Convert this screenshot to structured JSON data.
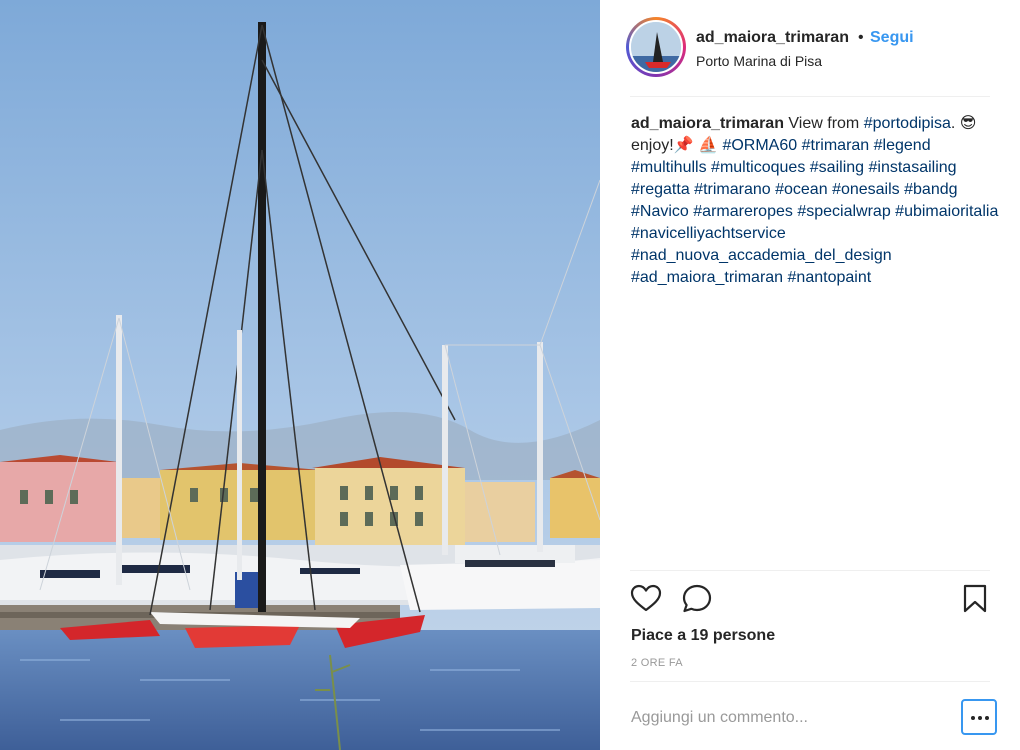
{
  "header": {
    "username": "ad_maiora_trimaran",
    "separator": "•",
    "follow_label": "Segui",
    "location": "Porto Marina di Pisa"
  },
  "caption": {
    "username": "ad_maiora_trimaran",
    "segments": [
      {
        "type": "text",
        "text": " View from "
      },
      {
        "type": "tag",
        "text": "#portodipisa"
      },
      {
        "type": "text",
        "text": ". "
      },
      {
        "type": "emoji",
        "text": "😎"
      },
      {
        "type": "text",
        "text": " enjoy!"
      },
      {
        "type": "emoji",
        "text": "📌"
      },
      {
        "type": "text",
        "text": " "
      },
      {
        "type": "emoji",
        "text": "⛵"
      },
      {
        "type": "text",
        "text": " "
      },
      {
        "type": "tag",
        "text": "#ORMA60"
      },
      {
        "type": "text",
        "text": " "
      },
      {
        "type": "tag",
        "text": "#trimaran"
      },
      {
        "type": "text",
        "text": " "
      },
      {
        "type": "tag",
        "text": "#legend"
      },
      {
        "type": "text",
        "text": " "
      },
      {
        "type": "tag",
        "text": "#multihulls"
      },
      {
        "type": "text",
        "text": " "
      },
      {
        "type": "tag",
        "text": "#multicoques"
      },
      {
        "type": "text",
        "text": " "
      },
      {
        "type": "tag",
        "text": "#sailing"
      },
      {
        "type": "text",
        "text": " "
      },
      {
        "type": "tag",
        "text": "#instasailing"
      },
      {
        "type": "text",
        "text": " "
      },
      {
        "type": "tag",
        "text": "#regatta"
      },
      {
        "type": "text",
        "text": " "
      },
      {
        "type": "tag",
        "text": "#trimarano"
      },
      {
        "type": "text",
        "text": " "
      },
      {
        "type": "tag",
        "text": "#ocean"
      },
      {
        "type": "text",
        "text": " "
      },
      {
        "type": "tag",
        "text": "#onesails"
      },
      {
        "type": "text",
        "text": " "
      },
      {
        "type": "tag",
        "text": "#bandg"
      },
      {
        "type": "text",
        "text": " "
      },
      {
        "type": "tag",
        "text": "#Navico"
      },
      {
        "type": "text",
        "text": " "
      },
      {
        "type": "tag",
        "text": "#armareropes"
      },
      {
        "type": "text",
        "text": " "
      },
      {
        "type": "tag",
        "text": "#specialwrap"
      },
      {
        "type": "text",
        "text": " "
      },
      {
        "type": "tag",
        "text": "#ubimaioritalia"
      },
      {
        "type": "text",
        "text": " "
      },
      {
        "type": "tag",
        "text": "#navicelliyachtservice"
      },
      {
        "type": "text",
        "text": " "
      },
      {
        "type": "tag",
        "text": "#nad_nuova_accademia_del_design"
      },
      {
        "type": "text",
        "text": " "
      },
      {
        "type": "tag",
        "text": "#ad_maiora_trimaran"
      },
      {
        "type": "text",
        "text": " "
      },
      {
        "type": "tag",
        "text": "#nantopaint"
      }
    ]
  },
  "actions": {
    "like_icon": "heart-outline-icon",
    "comment_icon": "speech-bubble-icon",
    "save_icon": "bookmark-outline-icon"
  },
  "likes_text": "Piace a 19 persone",
  "time_text": "2 ORE FA",
  "comment": {
    "placeholder": "Aggiungi un commento...",
    "value": ""
  },
  "more_icon": "ellipsis-icon",
  "colors": {
    "link_blue": "#3897f0",
    "hashtag": "#003569",
    "muted": "#999999",
    "divider": "#efefef"
  }
}
